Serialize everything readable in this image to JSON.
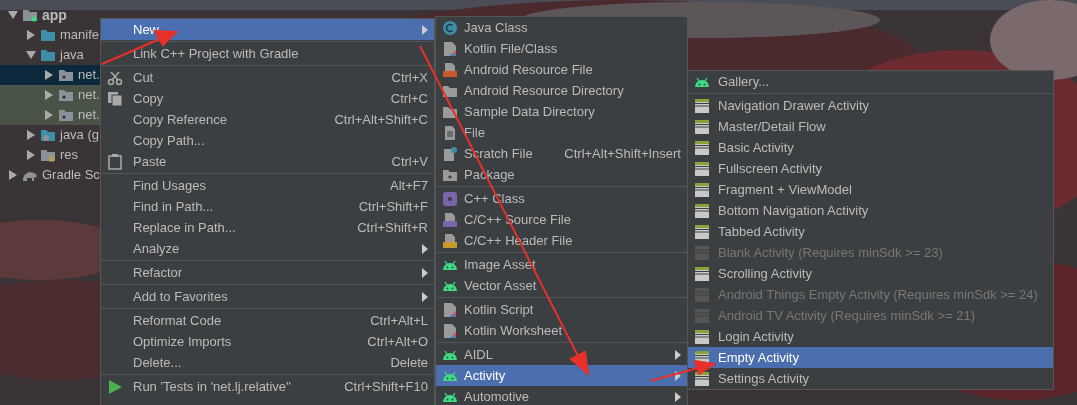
{
  "project_tree": [
    {
      "label": "app",
      "kind": "module",
      "expanded": true,
      "children": [
        {
          "label": "manife",
          "kind": "folder",
          "expanded": false
        },
        {
          "label": "java",
          "kind": "folder",
          "expanded": true,
          "children": [
            {
              "label": "net.",
              "kind": "package",
              "expanded": false,
              "selected": true,
              "highlight": false
            },
            {
              "label": "net.",
              "kind": "package",
              "expanded": false,
              "selected": false,
              "highlight": true
            },
            {
              "label": "net.",
              "kind": "package",
              "expanded": false,
              "selected": false,
              "highlight": true
            }
          ]
        },
        {
          "label": "java (g",
          "kind": "generated",
          "expanded": false
        },
        {
          "label": "res",
          "kind": "res",
          "expanded": false
        }
      ]
    },
    {
      "label": "Gradle Sc",
      "kind": "gradle",
      "expanded": false
    }
  ],
  "context_menu": {
    "groups": [
      [
        {
          "label": "New",
          "kind": "plain",
          "submenu": true,
          "selected": true
        }
      ],
      [
        {
          "label": "Link C++ Project with Gradle",
          "kind": "plain",
          "submenu": false,
          "selected": false
        }
      ],
      [
        {
          "label": "Cut",
          "shortcut": "Ctrl+X",
          "kind": "cut",
          "submenu": false,
          "selected": false
        },
        {
          "label": "Copy",
          "shortcut": "Ctrl+C",
          "kind": "copy",
          "submenu": false,
          "selected": false
        },
        {
          "label": "Copy Reference",
          "shortcut": "Ctrl+Alt+Shift+C",
          "kind": "plain",
          "submenu": false,
          "selected": false
        },
        {
          "label": "Copy Path...",
          "kind": "plain",
          "submenu": false,
          "selected": false
        },
        {
          "label": "Paste",
          "shortcut": "Ctrl+V",
          "kind": "paste",
          "submenu": false,
          "selected": false
        }
      ],
      [
        {
          "label": "Find Usages",
          "shortcut": "Alt+F7",
          "kind": "plain",
          "submenu": false,
          "selected": false
        },
        {
          "label": "Find in Path...",
          "shortcut": "Ctrl+Shift+F",
          "kind": "plain",
          "submenu": false,
          "selected": false
        },
        {
          "label": "Replace in Path...",
          "shortcut": "Ctrl+Shift+R",
          "kind": "plain",
          "submenu": false,
          "selected": false
        },
        {
          "label": "Analyze",
          "kind": "plain",
          "submenu": true,
          "selected": false
        }
      ],
      [
        {
          "label": "Refactor",
          "kind": "plain",
          "submenu": true,
          "selected": false
        }
      ],
      [
        {
          "label": "Add to Favorites",
          "kind": "plain",
          "submenu": true,
          "selected": false
        }
      ],
      [
        {
          "label": "Reformat Code",
          "shortcut": "Ctrl+Alt+L",
          "kind": "plain",
          "submenu": false,
          "selected": false
        },
        {
          "label": "Optimize Imports",
          "shortcut": "Ctrl+Alt+O",
          "kind": "plain",
          "submenu": false,
          "selected": false
        },
        {
          "label": "Delete...",
          "shortcut": "Delete",
          "kind": "plain",
          "submenu": false,
          "selected": false
        }
      ],
      [
        {
          "label": "Run 'Tests in 'net.lj.relative''",
          "shortcut": "Ctrl+Shift+F10",
          "kind": "run",
          "submenu": false,
          "selected": false
        }
      ]
    ]
  },
  "new_submenu": {
    "groups": [
      [
        {
          "label": "Java Class",
          "kind": "java-class",
          "submenu": false,
          "selected": false
        },
        {
          "label": "Kotlin File/Class",
          "kind": "kotlin",
          "submenu": false,
          "selected": false
        },
        {
          "label": "Android Resource File",
          "kind": "resource-file",
          "submenu": false,
          "selected": false
        },
        {
          "label": "Android Resource Directory",
          "kind": "folder",
          "submenu": false,
          "selected": false
        },
        {
          "label": "Sample Data Directory",
          "kind": "folder",
          "submenu": false,
          "selected": false
        },
        {
          "label": "File",
          "kind": "file",
          "submenu": false,
          "selected": false
        },
        {
          "label": "Scratch File",
          "shortcut": "Ctrl+Alt+Shift+Insert",
          "kind": "scratch",
          "submenu": false,
          "selected": false
        },
        {
          "label": "Package",
          "kind": "package",
          "submenu": false,
          "selected": false
        }
      ],
      [
        {
          "label": "C++ Class",
          "kind": "cpp-class",
          "submenu": false,
          "selected": false
        },
        {
          "label": "C/C++ Source File",
          "kind": "cpp-source",
          "submenu": false,
          "selected": false
        },
        {
          "label": "C/C++ Header File",
          "kind": "cpp-header",
          "submenu": false,
          "selected": false
        }
      ],
      [
        {
          "label": "Image Asset",
          "kind": "android",
          "submenu": false,
          "selected": false
        },
        {
          "label": "Vector Asset",
          "kind": "android",
          "submenu": false,
          "selected": false
        }
      ],
      [
        {
          "label": "Kotlin Script",
          "kind": "kotlin",
          "submenu": false,
          "selected": false
        },
        {
          "label": "Kotlin Worksheet",
          "kind": "kotlin",
          "submenu": false,
          "selected": false
        }
      ],
      [
        {
          "label": "AIDL",
          "kind": "android",
          "submenu": true,
          "selected": false
        },
        {
          "label": "Activity",
          "kind": "android",
          "submenu": true,
          "selected": true
        },
        {
          "label": "Automotive",
          "kind": "android",
          "submenu": true,
          "selected": false
        }
      ]
    ]
  },
  "activity_submenu": {
    "groups": [
      [
        {
          "label": "Gallery...",
          "kind": "android",
          "disabled": false,
          "selected": false
        }
      ],
      [
        {
          "label": "Navigation Drawer Activity",
          "kind": "template",
          "disabled": false,
          "selected": false
        },
        {
          "label": "Master/Detail Flow",
          "kind": "template",
          "disabled": false,
          "selected": false
        },
        {
          "label": "Basic Activity",
          "kind": "template",
          "disabled": false,
          "selected": false
        },
        {
          "label": "Fullscreen Activity",
          "kind": "template",
          "disabled": false,
          "selected": false
        },
        {
          "label": "Fragment + ViewModel",
          "kind": "template",
          "disabled": false,
          "selected": false
        },
        {
          "label": "Bottom Navigation Activity",
          "kind": "template",
          "disabled": false,
          "selected": false
        },
        {
          "label": "Tabbed Activity",
          "kind": "template",
          "disabled": false,
          "selected": false
        },
        {
          "label": "Blank Activity (Requires minSdk >= 23)",
          "kind": "template",
          "disabled": true,
          "selected": false
        },
        {
          "label": "Scrolling Activity",
          "kind": "template",
          "disabled": false,
          "selected": false
        },
        {
          "label": "Android Things Empty Activity (Requires minSdk >= 24)",
          "kind": "template",
          "disabled": true,
          "selected": false
        },
        {
          "label": "Android TV Activity (Requires minSdk >= 21)",
          "kind": "template",
          "disabled": true,
          "selected": false
        },
        {
          "label": "Login Activity",
          "kind": "template",
          "disabled": false,
          "selected": false
        },
        {
          "label": "Empty Activity",
          "kind": "template",
          "disabled": false,
          "selected": true
        },
        {
          "label": "Settings Activity",
          "kind": "template",
          "disabled": false,
          "selected": false
        }
      ]
    ]
  }
}
